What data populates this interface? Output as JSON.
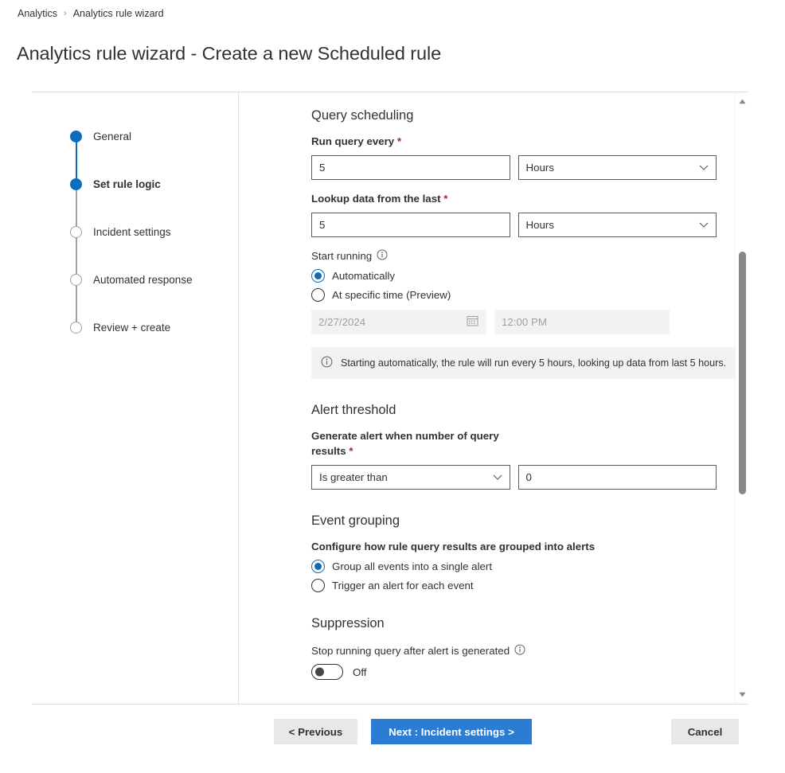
{
  "breadcrumb": {
    "items": [
      "Analytics",
      "Analytics rule wizard"
    ],
    "separator": "›"
  },
  "page": {
    "title": "Analytics rule wizard - Create a new Scheduled rule"
  },
  "steps": [
    {
      "label": "General",
      "state": "done"
    },
    {
      "label": "Set rule logic",
      "state": "current"
    },
    {
      "label": "Incident settings",
      "state": "todo"
    },
    {
      "label": "Automated response",
      "state": "todo"
    },
    {
      "label": "Review + create",
      "state": "todo"
    }
  ],
  "query_scheduling": {
    "heading": "Query scheduling",
    "run_query_every": {
      "label": "Run query every",
      "required": "*",
      "value": "5",
      "unit": "Hours"
    },
    "lookup_data": {
      "label": "Lookup data from the last",
      "required": "*",
      "value": "5",
      "unit": "Hours"
    },
    "start_running": {
      "label": "Start running",
      "info_icon": "info-icon",
      "options": [
        {
          "label": "Automatically",
          "selected": true
        },
        {
          "label": "At specific time (Preview)",
          "selected": false
        }
      ],
      "date_value": "2/27/2024",
      "time_value": "12:00 PM",
      "disabled": true
    },
    "info_message": "Starting automatically, the rule will run every 5 hours, looking up data from last 5 hours."
  },
  "alert_threshold": {
    "heading": "Alert threshold",
    "label": "Generate alert when number of query results",
    "required": "*",
    "operator": "Is greater than",
    "value": "0"
  },
  "event_grouping": {
    "heading": "Event grouping",
    "label": "Configure how rule query results are grouped into alerts",
    "options": [
      {
        "label": "Group all events into a single alert",
        "selected": true
      },
      {
        "label": "Trigger an alert for each event",
        "selected": false
      }
    ]
  },
  "suppression": {
    "heading": "Suppression",
    "label": "Stop running query after alert is generated",
    "info_icon": "info-icon",
    "toggle_state": "Off"
  },
  "footer": {
    "previous": "< Previous",
    "next": "Next : Incident settings >",
    "cancel": "Cancel"
  },
  "colors": {
    "accent": "#0f6cbd",
    "primary_button": "#2b7cd3",
    "required_star": "#a4262c",
    "info_background": "#f3f2f1",
    "border": "#605e5c"
  }
}
